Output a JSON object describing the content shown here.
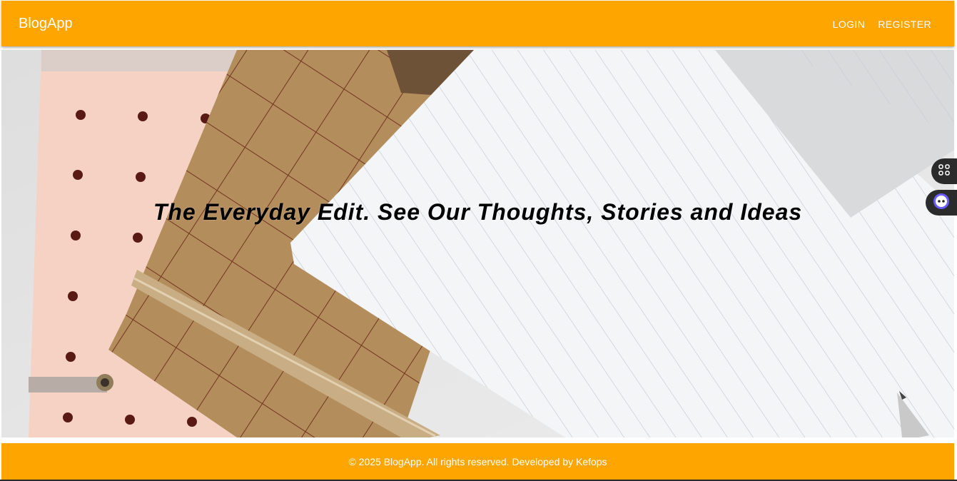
{
  "header": {
    "brand": "BlogApp",
    "nav": [
      {
        "label": "LOGIN"
      },
      {
        "label": "REGISTER"
      }
    ]
  },
  "hero": {
    "title": "The Everyday Edit. See Our Thoughts, Stories and Ideas"
  },
  "side_widgets": [
    {
      "icon": "apps-grid-icon"
    },
    {
      "icon": "assistant-bot-icon"
    }
  ],
  "footer": {
    "text": "© 2025 BlogApp. All rights reserved. Developed by Kefops"
  },
  "colors": {
    "accent": "#ffa500",
    "text_on_accent": "#ffffff",
    "hero_text": "#000000"
  }
}
